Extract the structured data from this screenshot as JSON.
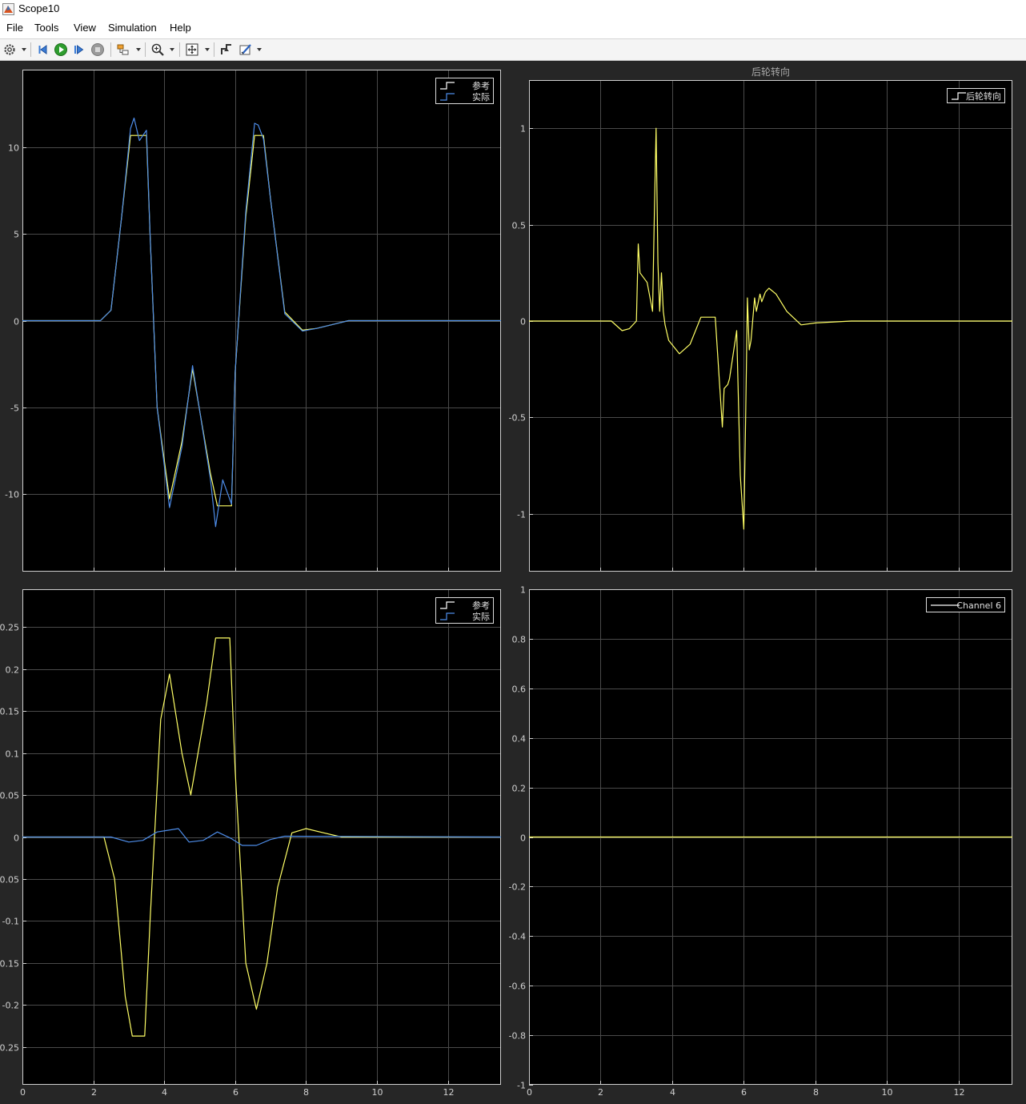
{
  "window": {
    "title": "Scope10"
  },
  "menu": {
    "items": [
      "File",
      "Tools",
      "View",
      "Simulation",
      "Help"
    ]
  },
  "toolbar": {
    "icons": [
      "gear-icon",
      "step-back-icon",
      "run-icon",
      "step-forward-icon",
      "stop-icon",
      "highlight-block-icon",
      "zoom-icon",
      "fit-to-view-icon",
      "triggers-icon",
      "measurements-icon"
    ]
  },
  "colors": {
    "background": "#262626",
    "axes": "#000000",
    "grid": "#4a4a4a",
    "yellow": "#ffff66",
    "blue": "#4d8ce8",
    "white": "#ffffff"
  },
  "chart_data": [
    {
      "type": "line",
      "title": "",
      "xlim": [
        0,
        13.5
      ],
      "ylim": [
        -14.5,
        14.5
      ],
      "xticks": [
        0,
        2,
        4,
        6,
        8,
        10,
        12
      ],
      "yticks": [
        -10,
        -5,
        0,
        5,
        10
      ],
      "ytick_labels": [
        "-10",
        "-5",
        "0",
        "5",
        "10"
      ],
      "show_x_ticklabels": false,
      "grid": true,
      "legend": {
        "position": "top-right",
        "entries": [
          "参考",
          "实际"
        ]
      },
      "series": [
        {
          "name": "参考",
          "color": "#ffff66",
          "x": [
            0,
            2.2,
            2.5,
            2.8,
            3.05,
            3.5,
            3.6,
            3.8,
            4.15,
            4.5,
            4.8,
            5.3,
            5.5,
            5.9,
            6.0,
            6.3,
            6.55,
            6.8,
            7.0,
            7.4,
            7.9,
            8.3,
            8.8,
            9.2,
            13.5
          ],
          "y": [
            0,
            0,
            0.6,
            6,
            10.7,
            10.7,
            5,
            -5,
            -10.3,
            -7,
            -2.8,
            -8.8,
            -10.7,
            -10.7,
            -3,
            6,
            10.7,
            10.7,
            7,
            0.5,
            -0.55,
            -0.45,
            -0.2,
            0,
            0
          ]
        },
        {
          "name": "实际",
          "color": "#4d8ce8",
          "x": [
            0,
            2.2,
            2.5,
            2.8,
            3.05,
            3.15,
            3.3,
            3.5,
            3.6,
            3.8,
            4.15,
            4.5,
            4.8,
            5.3,
            5.45,
            5.65,
            5.9,
            6.0,
            6.3,
            6.55,
            6.65,
            6.8,
            7.0,
            7.4,
            7.9,
            8.3,
            8.8,
            9.2,
            13.5
          ],
          "y": [
            0,
            0,
            0.6,
            6,
            11.1,
            11.7,
            10.4,
            11.0,
            5,
            -5,
            -10.8,
            -7.3,
            -2.6,
            -9.1,
            -11.9,
            -9.2,
            -10.6,
            -3,
            6.3,
            11.4,
            11.3,
            10.5,
            7,
            0.4,
            -0.6,
            -0.45,
            -0.2,
            0,
            0
          ]
        }
      ]
    },
    {
      "type": "line",
      "title": "后轮转向",
      "xlim": [
        0,
        13.5
      ],
      "ylim": [
        -1.3,
        1.25
      ],
      "xticks": [
        0,
        2,
        4,
        6,
        8,
        10,
        12
      ],
      "yticks": [
        -1,
        -0.5,
        0,
        0.5,
        1
      ],
      "ytick_labels": [
        "-1",
        "-0.5",
        "0",
        "0.5",
        "1"
      ],
      "show_x_ticklabels": false,
      "grid": true,
      "legend": {
        "position": "top-right",
        "entries": [
          "后轮转向"
        ]
      },
      "series": [
        {
          "name": "后轮转向",
          "color": "#ffff66",
          "x": [
            0,
            2.3,
            2.6,
            2.8,
            3.0,
            3.05,
            3.1,
            3.3,
            3.45,
            3.5,
            3.55,
            3.6,
            3.65,
            3.7,
            3.75,
            3.8,
            3.9,
            4.2,
            4.5,
            4.8,
            5.2,
            5.4,
            5.45,
            5.55,
            5.6,
            5.8,
            5.9,
            6.0,
            6.05,
            6.1,
            6.15,
            6.2,
            6.3,
            6.35,
            6.45,
            6.5,
            6.6,
            6.7,
            6.9,
            7.2,
            7.6,
            8.0,
            9.0,
            13.5
          ],
          "y": [
            0,
            0,
            -0.05,
            -0.04,
            0,
            0.4,
            0.25,
            0.2,
            0.05,
            0.55,
            1.0,
            0.3,
            0.05,
            0.25,
            0.05,
            -0.02,
            -0.1,
            -0.17,
            -0.12,
            0.02,
            0.02,
            -0.55,
            -0.35,
            -0.33,
            -0.3,
            -0.05,
            -0.8,
            -1.08,
            -0.5,
            0.12,
            -0.15,
            -0.1,
            0.12,
            0.05,
            0.14,
            0.1,
            0.15,
            0.17,
            0.14,
            0.05,
            -0.02,
            -0.01,
            0,
            0
          ]
        }
      ]
    },
    {
      "type": "line",
      "title": "",
      "xlim": [
        0,
        13.5
      ],
      "ylim": [
        -0.295,
        0.295
      ],
      "xticks": [
        0,
        2,
        4,
        6,
        8,
        10,
        12
      ],
      "xtick_labels": [
        "0",
        "2",
        "4",
        "6",
        "8",
        "10",
        "12"
      ],
      "yticks": [
        -0.25,
        -0.2,
        -0.15,
        -0.1,
        -0.05,
        0,
        0.05,
        0.1,
        0.15,
        0.2,
        0.25
      ],
      "ytick_labels": [
        "-0.25",
        "-0.2",
        "-0.15",
        "-0.1",
        "-0.05",
        "0",
        "0.05",
        "0.1",
        "0.15",
        "0.2",
        "0.25"
      ],
      "show_x_ticklabels": true,
      "grid": true,
      "legend": {
        "position": "top-right",
        "entries": [
          "参考",
          "实际"
        ]
      },
      "series": [
        {
          "name": "参考",
          "color": "#ffff66",
          "x": [
            0,
            2.3,
            2.6,
            2.9,
            3.1,
            3.45,
            3.6,
            3.9,
            4.15,
            4.5,
            4.75,
            5.2,
            5.45,
            5.85,
            6.0,
            6.3,
            6.6,
            6.9,
            7.2,
            7.6,
            8.0,
            8.5,
            9.0,
            9.8,
            13.5
          ],
          "y": [
            0,
            0,
            -0.05,
            -0.19,
            -0.237,
            -0.237,
            -0.1,
            0.14,
            0.194,
            0.1,
            0.05,
            0.16,
            0.237,
            0.237,
            0.08,
            -0.15,
            -0.205,
            -0.15,
            -0.06,
            0.005,
            0.01,
            0.005,
            0,
            0,
            0
          ]
        },
        {
          "name": "实际",
          "color": "#4d8ce8",
          "x": [
            0,
            2.5,
            3.0,
            3.4,
            3.8,
            4.1,
            4.4,
            4.7,
            5.1,
            5.5,
            5.9,
            6.2,
            6.6,
            7.0,
            7.4,
            13.5
          ],
          "y": [
            0,
            0,
            -0.006,
            -0.004,
            0.006,
            0.008,
            0.01,
            -0.006,
            -0.004,
            0.006,
            -0.002,
            -0.01,
            -0.01,
            -0.003,
            0.001,
            0
          ]
        }
      ]
    },
    {
      "type": "line",
      "title": "",
      "xlim": [
        0,
        13.5
      ],
      "ylim": [
        -1,
        1
      ],
      "xticks": [
        0,
        2,
        4,
        6,
        8,
        10,
        12
      ],
      "xtick_labels": [
        "0",
        "2",
        "4",
        "6",
        "8",
        "10",
        "12"
      ],
      "yticks": [
        -1,
        -0.8,
        -0.6,
        -0.4,
        -0.2,
        0,
        0.2,
        0.4,
        0.6,
        0.8,
        1
      ],
      "ytick_labels": [
        "-1",
        "-0.8",
        "-0.6",
        "-0.4",
        "-0.2",
        "0",
        "0.2",
        "0.4",
        "0.6",
        "0.8",
        "1"
      ],
      "show_x_ticklabels": true,
      "grid": true,
      "legend": {
        "position": "top-right",
        "entries": [
          "Channel 6"
        ]
      },
      "series": [
        {
          "name": "Channel 6",
          "color": "#ffff66",
          "legend_color": "#ffffff",
          "x": [
            0,
            13.5
          ],
          "y": [
            0,
            0
          ]
        }
      ]
    }
  ]
}
